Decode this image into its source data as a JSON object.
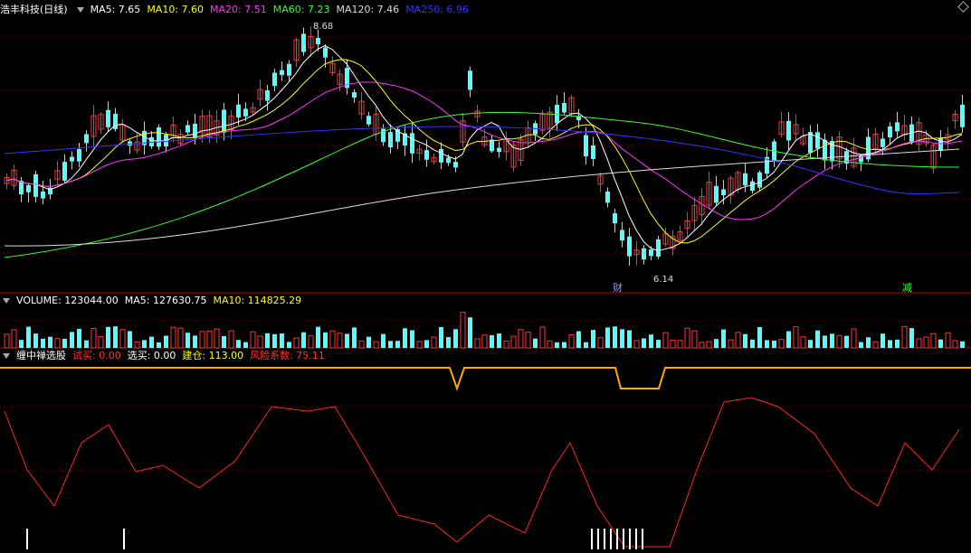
{
  "price_panel": {
    "stock_name": "浩丰科技(日线)",
    "indicators": [
      {
        "label": "MA5: 7.65",
        "color": "#ffffff"
      },
      {
        "label": "MA10: 7.60",
        "color": "#ffff00"
      },
      {
        "label": "MA20: 7.51",
        "color": "#ff33ff"
      },
      {
        "label": "MA60: 7.23",
        "color": "#33ff33"
      },
      {
        "label": "MA120: 7.46",
        "color": "#dddddd"
      },
      {
        "label": "MA250: 6.96",
        "color": "#3333ff"
      }
    ],
    "high_label": "8.68",
    "low_label": "6.14",
    "marker_cai": "财",
    "marker_jian": "减"
  },
  "volume_panel": {
    "label": "VOLUME: 123044.00",
    "ma5": "MA5: 127630.75",
    "ma10": "MA10: 114825.29"
  },
  "indicator_panel": {
    "name": "缠中禅选股",
    "items": [
      {
        "label": "试买: 0.00",
        "color": "#ff3333"
      },
      {
        "label": "选买: 0.00",
        "color": "#ffffff"
      },
      {
        "label": "建仓: 113.00",
        "color": "#ffff00"
      },
      {
        "label": "风险系数: 75.11",
        "color": "#ff3333"
      }
    ]
  },
  "colors": {
    "up": "#ff3333",
    "down": "#54ffff",
    "grid": "#7a0000",
    "divider": "#c00000"
  }
}
